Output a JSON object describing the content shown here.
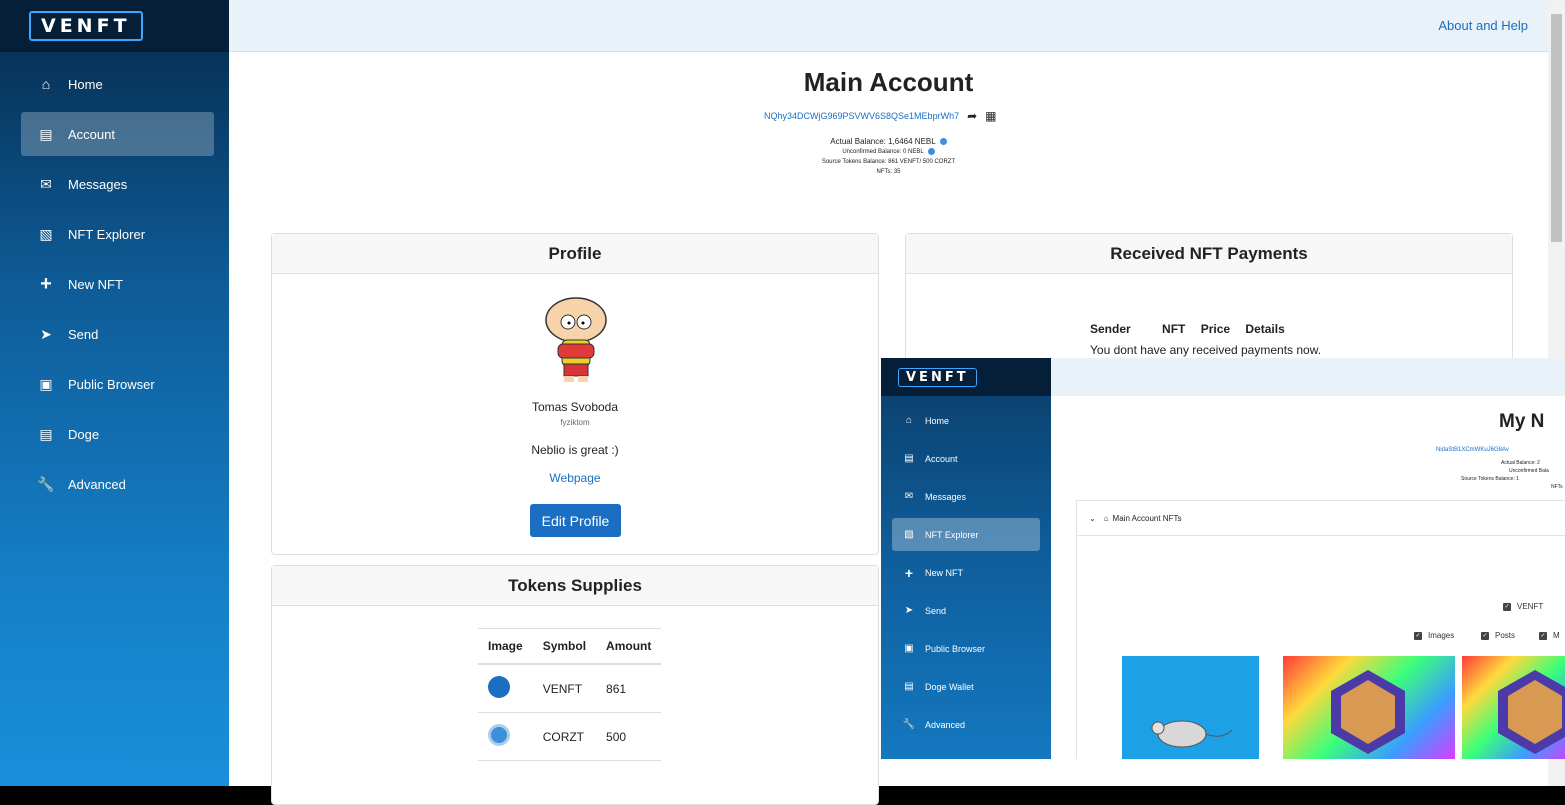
{
  "app": {
    "logo": "VENFT"
  },
  "sidebar": {
    "items": [
      {
        "label": "Home",
        "icon": "home-icon"
      },
      {
        "label": "Account",
        "icon": "wallet-icon"
      },
      {
        "label": "Messages",
        "icon": "envelope-icon"
      },
      {
        "label": "NFT Explorer",
        "icon": "folder-icon"
      },
      {
        "label": "New NFT",
        "icon": "plus-icon"
      },
      {
        "label": "Send",
        "icon": "send-icon"
      },
      {
        "label": "Public Browser",
        "icon": "calendar-icon"
      },
      {
        "label": "Doge",
        "icon": "wallet-icon"
      },
      {
        "label": "Advanced",
        "icon": "wrench-icon"
      }
    ],
    "active": "Account"
  },
  "header": {
    "help_link": "About and Help"
  },
  "main": {
    "title": "Main Account",
    "address": "NQhy34DCWjG969PSVWV6S8QSe1MEbprWh7",
    "balance": "Actual Balance: 1,6464 NEBL",
    "unconfirmed": "Unconfirmed Balance: 0 NEBL",
    "source_tokens": "Source Tokens Balance: 861 VENFT/ 500 CORZT",
    "nfts": "NFTs: 35"
  },
  "profile": {
    "header": "Profile",
    "name": "Tomas Svoboda",
    "handle": "fyziktom",
    "bio": "Neblio is great :)",
    "webpage": "Webpage",
    "edit_button": "Edit Profile"
  },
  "tokens": {
    "header": "Tokens Supplies",
    "columns": [
      "Image",
      "Symbol",
      "Amount"
    ],
    "rows": [
      {
        "symbol": "VENFT",
        "amount": "861",
        "color": "#1b6ec2"
      },
      {
        "symbol": "CORZT",
        "amount": "500",
        "color": "#3c8fd8"
      }
    ]
  },
  "payments": {
    "header": "Received NFT Payments",
    "columns": [
      "Sender",
      "NFT",
      "Price",
      "Details"
    ],
    "empty": "You dont have any received payments now."
  },
  "overlay": {
    "logo": "VENFT",
    "nav": [
      {
        "label": "Home",
        "icon": "home-icon"
      },
      {
        "label": "Account",
        "icon": "wallet-icon"
      },
      {
        "label": "Messages",
        "icon": "envelope-icon"
      },
      {
        "label": "NFT Explorer",
        "icon": "folder-icon"
      },
      {
        "label": "New NFT",
        "icon": "plus-icon"
      },
      {
        "label": "Send",
        "icon": "send-icon"
      },
      {
        "label": "Public Browser",
        "icon": "calendar-icon"
      },
      {
        "label": "Doge Wallet",
        "icon": "wallet-icon"
      },
      {
        "label": "Advanced",
        "icon": "wrench-icon"
      }
    ],
    "active": "NFT Explorer",
    "title": "My N",
    "address": "NidaStB1XCmWKuJ6G8Av",
    "bal_1": "Actual Balance: 2",
    "bal_2": "Unconfirmed Bala",
    "bal_3": "Source Tokens Balance: 1",
    "bal_4": "NFTs",
    "panel_title": "Main Account NFTs",
    "filter_venft": "VENFT",
    "filter_images": "Images",
    "filter_posts": "Posts",
    "filter_more": "M"
  }
}
